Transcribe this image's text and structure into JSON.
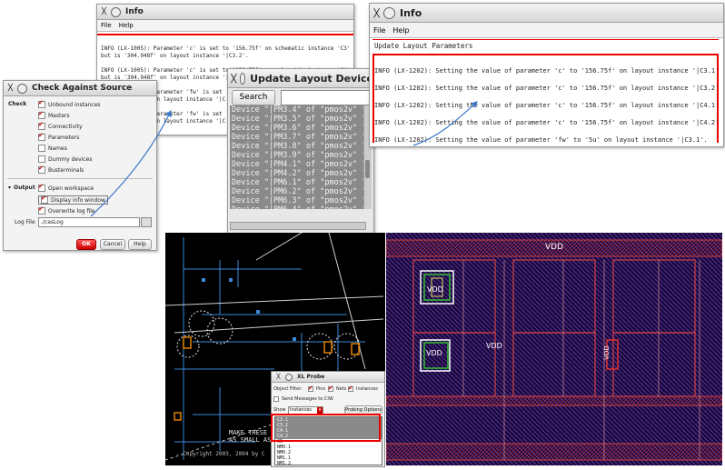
{
  "info_top": {
    "title": "Info",
    "menu": [
      "File",
      "Help"
    ],
    "lines": [
      "INFO (LX-1005): Parameter 'c' is set to '156.75f' on schematic instance 'C3'",
      "but is '304.948f' on layout instance '|C3.2'.",
      "",
      "INFO (LX-1005): Parameter 'c' is set to '156.75f' on schematic instance 'C4'",
      "but is '304.948f' on layout instance '|C4.1'.",
      "",
      "INFO (LX-1005): Parameter 'fw' is set",
      "but is '6.755u' on layout instance '|C",
      "",
      "INFO (LX-1005): Parameter 'fw' is set",
      "but is '6.755u' on layout instance '|C"
    ]
  },
  "check_against_source": {
    "title": "Check Against Source",
    "check_label": "Check",
    "options": [
      {
        "label": "Unbound instances",
        "checked": true
      },
      {
        "label": "Masters",
        "checked": true
      },
      {
        "label": "Connectivity",
        "checked": true
      },
      {
        "label": "Parameters",
        "checked": true
      },
      {
        "label": "Names",
        "checked": false
      },
      {
        "label": "Dummy devices",
        "checked": false
      },
      {
        "label": "Busterminals",
        "checked": true
      }
    ],
    "output_label": "Output",
    "output_options": [
      {
        "label": "Open workspace",
        "checked": true
      },
      {
        "label": "Display info window",
        "checked": true
      },
      {
        "label": "Overwrite log file",
        "checked": true
      }
    ],
    "logfile_label": "Log File",
    "logfile_value": "./casLog",
    "ok_label": "OK",
    "cancel_label": "Cancel",
    "help_label": "Help"
  },
  "update_layout": {
    "title": "Update Layout Device",
    "search_label": "Search",
    "devices": [
      "Device \"|PM3.4\" of \"pmos2v\" \"layout\"",
      "Device \"|PM3.5\" of \"pmos2v\" \"layout\"",
      "Device \"|PM3.6\" of \"pmos2v\" \"layout\"",
      "Device \"|PM3.7\" of \"pmos2v\" \"layout\"",
      "Device \"|PM3.8\" of \"pmos2v\" \"layout\"",
      "Device \"|PM3.9\" of \"pmos2v\" \"layout\"",
      "Device \"|PM4.1\" of \"pmos2v\" \"layout\"",
      "Device \"|PM4.2\" of \"pmos2v\" \"layout\"",
      "Device \"|PM6.1\" of \"pmos2v\" \"layout\"",
      "Device \"|PM6.2\" of \"pmos2v\" \"layout\"",
      "Device \"|PM6.3\" of \"pmos2v\" \"layout\"",
      "Device \"|PM6.4\" of \"pmos2v\" \"layout\""
    ]
  },
  "info_right": {
    "title": "Info",
    "menu": [
      "File",
      "Help"
    ],
    "header": "Update Layout Parameters",
    "lines": [
      "INFO (LX-1202): Setting the value of parameter 'c' to '156.75f' on layout instance '|C3.1'",
      "INFO (LX-1202): Setting the value of parameter 'c' to '156.75f' on layout instance '|C3.2'",
      "INFO (LX-1202): Setting the value of parameter 'c' to '156.75f' on layout instance '|C4.1'",
      "INFO (LX-1202): Setting the value of parameter 'c' to '156.75f' on layout instance '|C4.2'",
      "INFO (LX-1202): Setting the value of parameter 'fw' to '5u' on layout instance '|C3.1'."
    ]
  },
  "schematic": {
    "note_line1": "MAKE THESE",
    "note_line2": "AS SMALL AS",
    "copyright": "- Copyright 2003, 2004 by C"
  },
  "xl_probe": {
    "title": "XL Probe",
    "filter_label": "Object Filter:",
    "filters": [
      {
        "label": "Pins",
        "checked": true
      },
      {
        "label": "Nets",
        "checked": true
      },
      {
        "label": "Instances",
        "checked": true
      }
    ],
    "send_label": "Send Messages to CIW",
    "show_label": "Show",
    "show_value": "Instances",
    "options_label": "Probing Options",
    "items": [
      "C3.1",
      "C3.2",
      "C4.1",
      "C4.2",
      "C5",
      "NM0.1",
      "NM0.2",
      "NM1.1",
      "NM1.2"
    ]
  },
  "layout": {
    "vdd_labels": [
      "VDD",
      "VDD",
      "VDD",
      "VDD",
      "VDD"
    ]
  },
  "colors": {
    "accent_red": "#e00000",
    "arrow_blue": "#3a78c9",
    "schematic_bg": "#000000",
    "layout_bg": "#1a0a3a"
  }
}
